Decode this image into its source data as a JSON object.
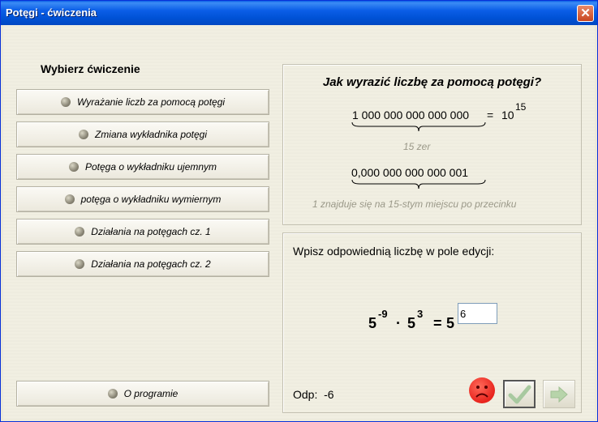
{
  "window": {
    "title": "Potęgi - ćwiczenia",
    "close_glyph": "✕"
  },
  "sidebar": {
    "heading": "Wybierz  ćwiczenie",
    "items": [
      {
        "label": "Wyrażanie liczb za pomocą potęgi"
      },
      {
        "label": "Zmiana wykładnika potęgi"
      },
      {
        "label": "Potęga o wykładniku ujemnym"
      },
      {
        "label": "potęga o wykładniku wymiernym"
      },
      {
        "label": "Działania na potęgach cz. 1"
      },
      {
        "label": "Działania na potęgach  cz. 2"
      }
    ],
    "about_label": "O programie"
  },
  "explanation": {
    "title": "Jak wyrazić liczbę za pomocą potęgi?",
    "big_number": "1 000 000 000 000 000",
    "equals": "=",
    "base": "10",
    "exponent": "15",
    "note1": "15 zer",
    "small_number": "0,000 000 000 000 001",
    "note2": "1 znajduje się na 15-stym miejscu po przecinku"
  },
  "exercise": {
    "instruction": "Wpisz odpowiednią liczbę w pole edycji:",
    "base1": "5",
    "exp1": "-9",
    "dot": "·",
    "base2": "5",
    "exp2": "3",
    "equals": "=",
    "base3": "5",
    "answer_value": "6",
    "odp_label": "Odp:",
    "odp_value": "-6"
  },
  "colors": {
    "accent": "#0052d6",
    "sad_face": "#e8241d",
    "check": "#5fae3c"
  },
  "icons": {
    "sad": "sad-face-icon",
    "check": "check-icon",
    "next": "arrow-right-icon"
  }
}
